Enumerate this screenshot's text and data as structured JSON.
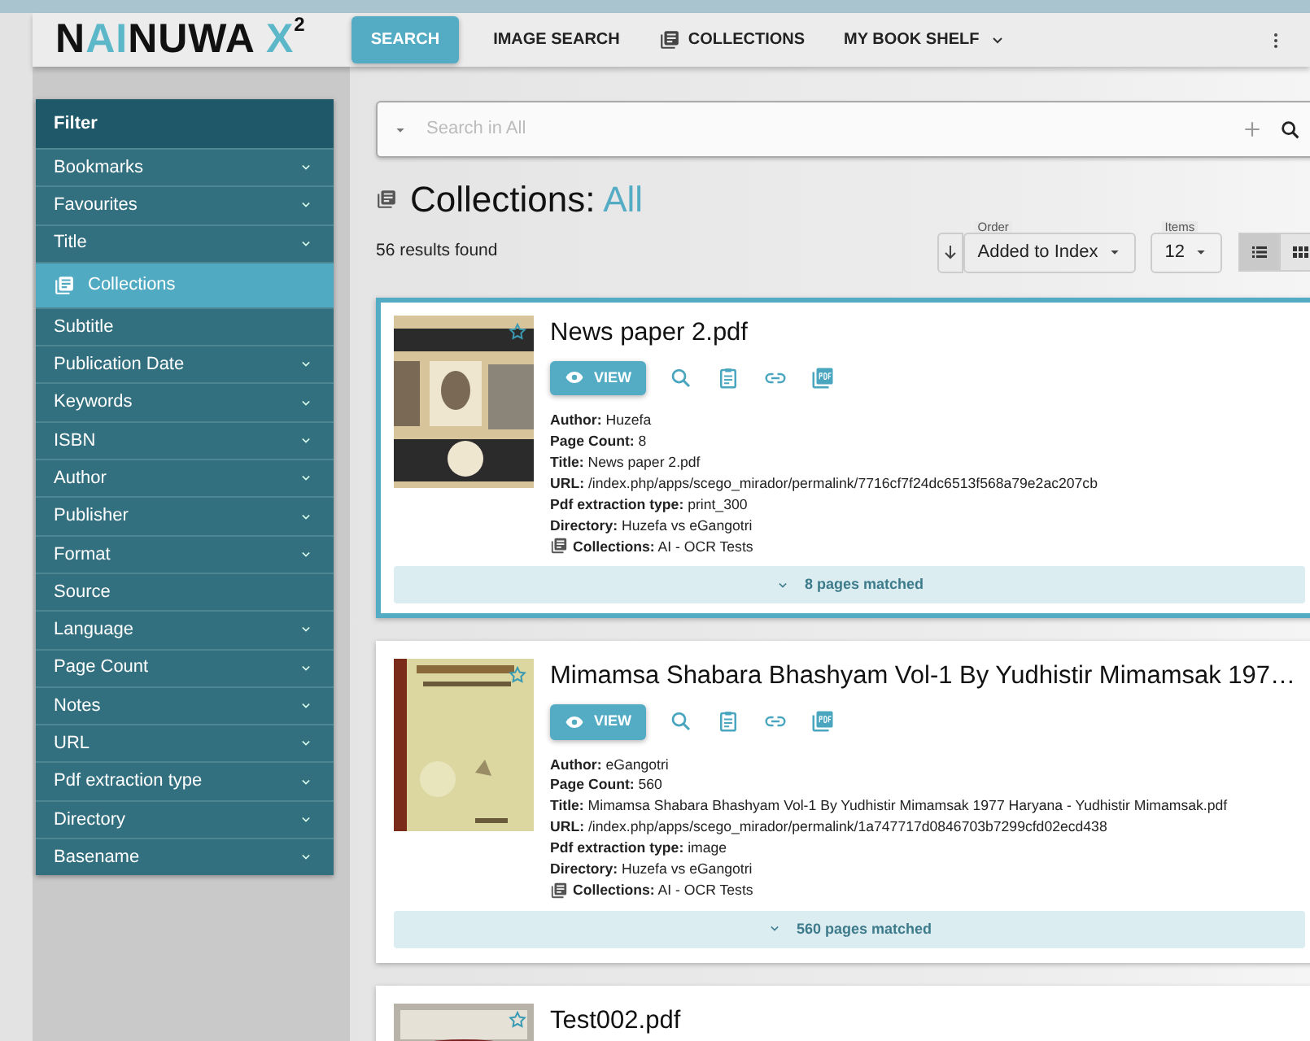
{
  "header": {
    "logo": [
      {
        "text": "N",
        "accent": false,
        "raised": false
      },
      {
        "text": "AI",
        "accent": true,
        "raised": false
      },
      {
        "text": "NUWA ",
        "accent": false,
        "raised": false
      },
      {
        "text": "X",
        "accent": true,
        "raised": false
      },
      {
        "text": "2",
        "accent": false,
        "raised": true
      }
    ],
    "nav": [
      {
        "label": "SEARCH",
        "selected": true,
        "kind": "plain"
      },
      {
        "label": "IMAGE SEARCH",
        "selected": false,
        "kind": "plain"
      },
      {
        "label": "COLLECTIONS",
        "selected": false,
        "kind": "icon"
      },
      {
        "label": "MY BOOK SHELF",
        "selected": false,
        "kind": "dropdown"
      }
    ]
  },
  "sidebar": {
    "title": "Filter",
    "items": [
      {
        "label": "Bookmarks",
        "kind": "text",
        "expandable": true,
        "selected": false
      },
      {
        "label": "Favourites",
        "kind": "text",
        "expandable": true,
        "selected": false
      },
      {
        "label": "Title",
        "kind": "text",
        "expandable": true,
        "selected": false
      },
      {
        "label": "Collections",
        "kind": "icon",
        "expandable": false,
        "selected": true
      },
      {
        "label": "Subtitle",
        "kind": "text",
        "expandable": false,
        "selected": false
      },
      {
        "label": "Publication Date",
        "kind": "text",
        "expandable": true,
        "selected": false
      },
      {
        "label": "Keywords",
        "kind": "text",
        "expandable": true,
        "selected": false
      },
      {
        "label": "ISBN",
        "kind": "text",
        "expandable": true,
        "selected": false
      },
      {
        "label": "Author",
        "kind": "text",
        "expandable": true,
        "selected": false
      },
      {
        "label": "Publisher",
        "kind": "text",
        "expandable": true,
        "selected": false
      },
      {
        "label": "Format",
        "kind": "text",
        "expandable": true,
        "selected": false
      },
      {
        "label": "Source",
        "kind": "text",
        "expandable": false,
        "selected": false
      },
      {
        "label": "Language",
        "kind": "text",
        "expandable": true,
        "selected": false
      },
      {
        "label": "Page Count",
        "kind": "text",
        "expandable": true,
        "selected": false
      },
      {
        "label": "Notes",
        "kind": "text",
        "expandable": true,
        "selected": false
      },
      {
        "label": "URL",
        "kind": "text",
        "expandable": true,
        "selected": false
      },
      {
        "label": "Pdf extraction type",
        "kind": "text",
        "expandable": true,
        "selected": false
      },
      {
        "label": "Directory",
        "kind": "text",
        "expandable": true,
        "selected": false
      },
      {
        "label": "Basename",
        "kind": "text",
        "expandable": true,
        "selected": false
      }
    ]
  },
  "search": {
    "placeholder": "Search in All"
  },
  "heading": {
    "prefix": "Collections:",
    "scope": "All"
  },
  "results_count": "56 results found",
  "toolbar": {
    "order_label": "Order",
    "order_value": "Added to Index",
    "items_label": "Items",
    "items_value": "12",
    "views": [
      {
        "kind": "list",
        "selected": true
      },
      {
        "kind": "grid",
        "selected": false
      }
    ]
  },
  "results": [
    {
      "title": "News paper 2.pdf",
      "selected": true,
      "button": "VIEW",
      "lines": [
        "**Author:** Huzefa",
        "**Page Count:** 8",
        "**Title:** News paper 2.pdf",
        "**URL:** /index.php/apps/scego_mirador/permalink/7716cf7f24dc6513f568a79e2ac207cb",
        "**Pdf extraction type:** print_300",
        "**Directory:** Huzefa vs eGangotri"
      ],
      "collections": "**Collections:** AI - OCR Tests",
      "matched": "8 pages matched"
    },
    {
      "title": "Mimamsa Shabara Bhashyam Vol-1 By Yudhistir Mimamsak 197…",
      "selected": false,
      "button": "VIEW",
      "lines": [
        "**Author:** eGangotri",
        "**Page Count:** 560",
        "**Title:** Mimamsa Shabara Bhashyam Vol-1 By Yudhistir Mimamsak 1977 Haryana - Yudhistir Mimamsak.pdf",
        "**URL:** /index.php/apps/scego_mirador/permalink/1a747717d0846703b7299cfd02ecd438",
        "**Pdf extraction type:** image",
        "**Directory:** Huzefa vs eGangotri"
      ],
      "collections": "**Collections:** AI - OCR Tests",
      "matched": "560 pages matched"
    },
    {
      "title": "Test002.pdf",
      "selected": false
    }
  ]
}
